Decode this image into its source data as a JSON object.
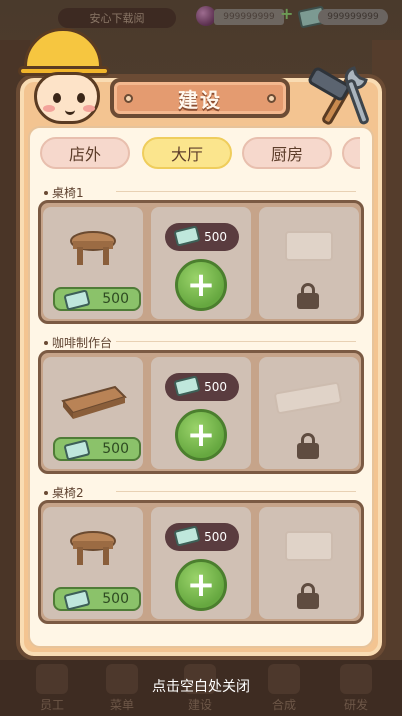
{
  "topbar": {
    "download_label": "安心下载阅",
    "gems": "999999999",
    "cash": "999999999"
  },
  "modal": {
    "title": "建设",
    "tabs": [
      {
        "label": "店外",
        "active": false
      },
      {
        "label": "大厅",
        "active": true
      },
      {
        "label": "厨房",
        "active": false
      }
    ],
    "sections": [
      {
        "label": "桌椅1",
        "owned_price": "500",
        "unlock_cost": "500",
        "item": "round-table"
      },
      {
        "label": "咖啡制作台",
        "owned_price": "500",
        "unlock_cost": "500",
        "item": "wood-counter"
      },
      {
        "label": "桌椅2",
        "owned_price": "500",
        "unlock_cost": "500",
        "item": "round-table"
      }
    ]
  },
  "bottom_nav": {
    "items": [
      "员工",
      "菜单",
      "建设",
      "合成",
      "研发"
    ]
  },
  "close_hint": "点击空白处关闭",
  "colors": {
    "accent_green": "#8bc26a",
    "banner": "#e49b70",
    "tab_active": "#fbe58d"
  }
}
